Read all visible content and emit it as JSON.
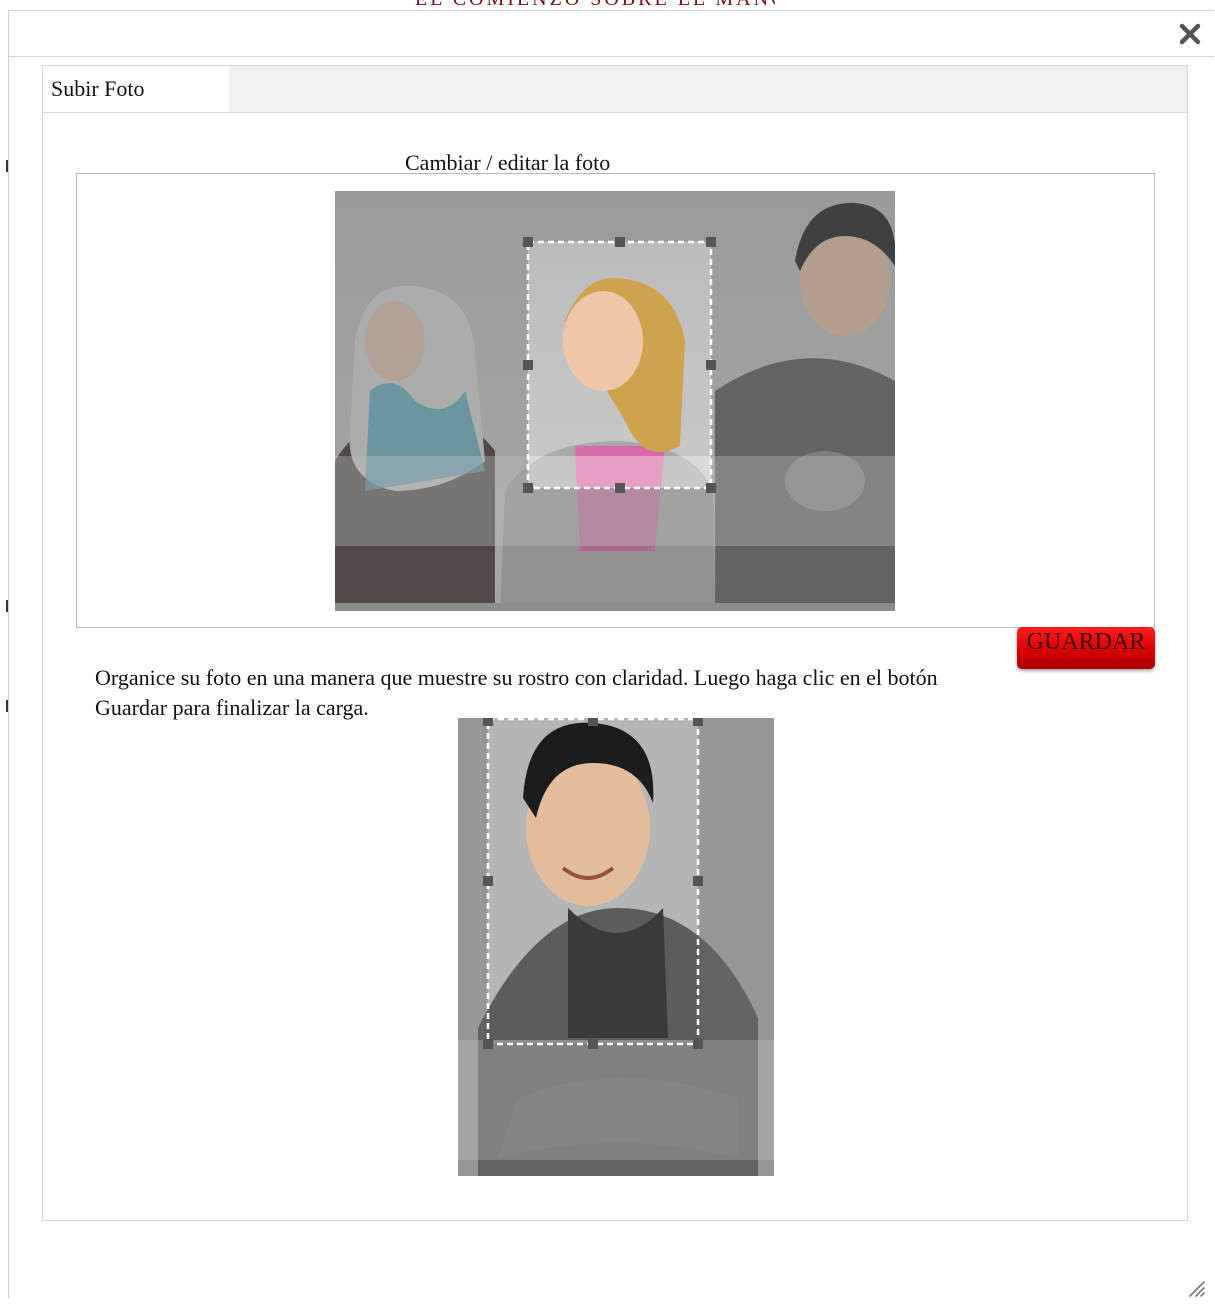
{
  "background": {
    "strip_text": "EL COMIENZO SOBRE EL MANOLITO ANDANTE"
  },
  "dialog": {
    "close_icon": "close-icon",
    "tab": {
      "label": "Subir Foto"
    },
    "section_title": "Cambiar / editar la foto",
    "save_button": "GUARDAR",
    "instructions": "Organice su foto en una manera que muestre su rostro con claridad. Luego haga clic en el botón Guardar para finalizar la carga.",
    "resize_icon": "resize-grip-icon"
  },
  "colors": {
    "save_button": "#d40000",
    "crop_overlay": "#8a8a8a",
    "border": "#d6d6d6"
  }
}
